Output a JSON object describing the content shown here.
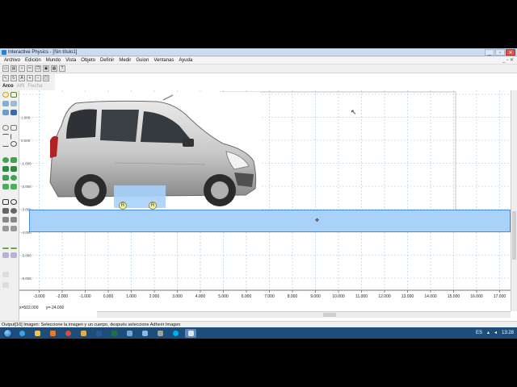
{
  "window": {
    "title": "Interactive Physics - [Sin título1]",
    "controls": {
      "minimize": "_",
      "maximize": "▫",
      "close": "✕"
    }
  },
  "menu": {
    "items": [
      "Archivo",
      "Edición",
      "Mundo",
      "Vista",
      "Objeto",
      "Definir",
      "Medir",
      "Guion",
      "Ventanas",
      "Ayuda"
    ],
    "mdi_controls": "_ ▫ ✕"
  },
  "tool_tabs": {
    "active": "Arco",
    "inactive": [
      "Alfil",
      "Flecha"
    ]
  },
  "ruler": {
    "x_labels": [
      "-3.000",
      "-2.000",
      "-1.000",
      "0.000",
      "1.000",
      "2.000",
      "3.000",
      "4.000",
      "5.000",
      "6.000",
      "7.000",
      "8.000",
      "9.000",
      "10.000",
      "11.000",
      "12.000",
      "13.000",
      "14.000",
      "15.000",
      "16.000",
      "17.000"
    ],
    "y_labels": [
      "1.000",
      "0.000",
      "-1.000",
      "-2.000",
      "-3.000",
      "-4.000",
      "-5.000",
      "-6.000",
      "-7.000"
    ]
  },
  "coords": {
    "x": "x=502.000",
    "y": "y=-24.000"
  },
  "status": {
    "text": "Output[16]  Imagen:  Seleccione la imagen y un cuerpo, después seleccione Adherir Imagen"
  },
  "taskbar": {
    "clock": "13:28",
    "lang": "ES"
  },
  "joints": [
    "R",
    "R"
  ],
  "colors": {
    "floor": "#a9d2fb",
    "floor_border": "#4a8ed6",
    "body": "#a9d2fb",
    "grid": "#9ec9e0",
    "joint": "#f4f0a8"
  },
  "icons": {
    "toolbar": [
      "new-icon",
      "open-icon",
      "save-icon",
      "cut-icon",
      "copy-icon",
      "paste-icon",
      "print-icon",
      "help-icon"
    ],
    "tools": [
      "pointer-icon",
      "rotate-icon",
      "text-icon",
      "zoom-in-icon",
      "zoom-out-icon",
      "fit-icon"
    ]
  }
}
